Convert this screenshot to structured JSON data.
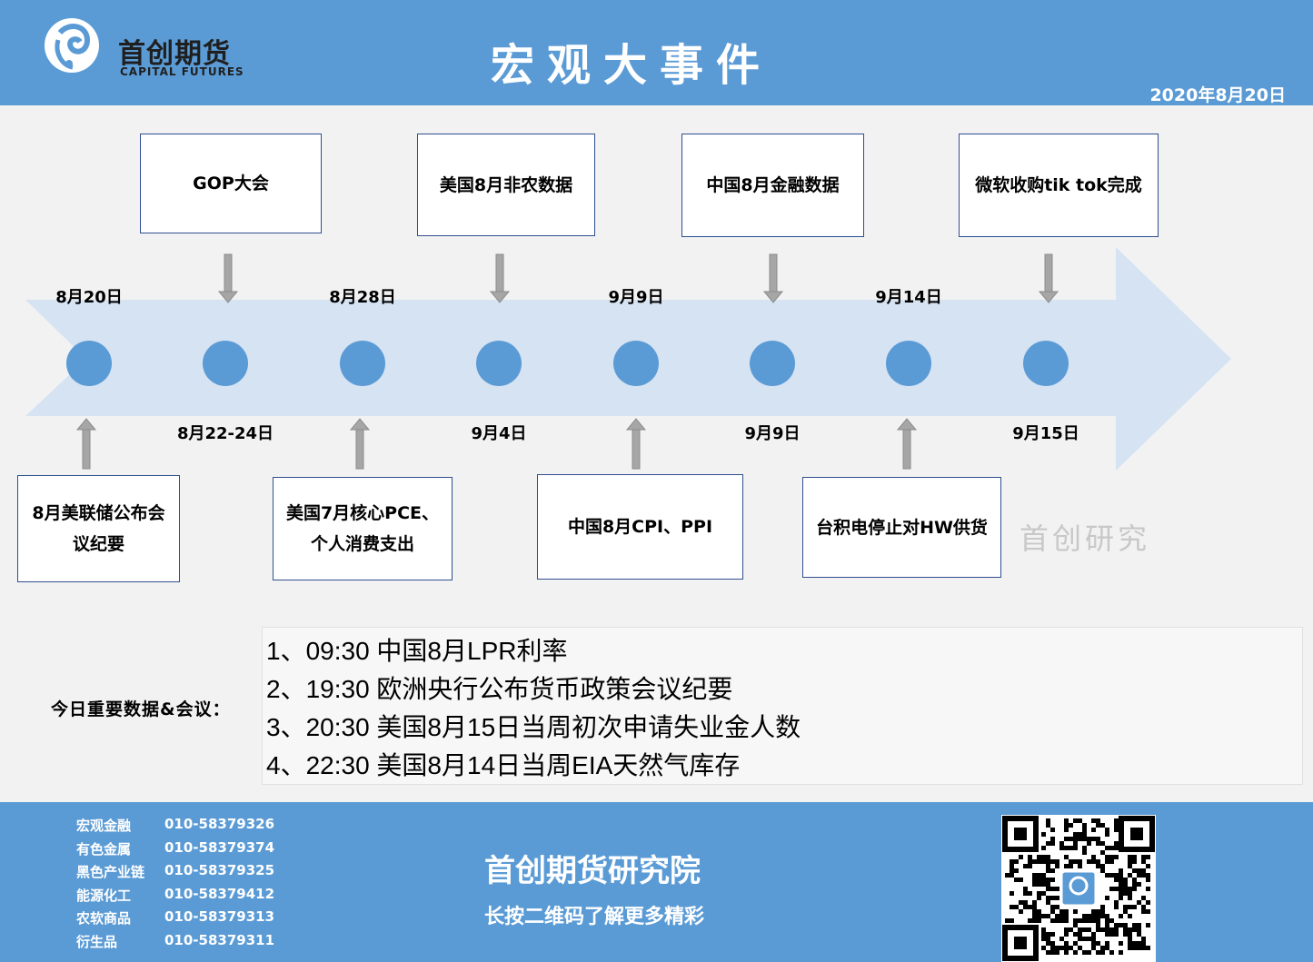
{
  "header": {
    "logo_cn": "首创期货",
    "logo_en": "CAPITAL FUTURES",
    "title": "宏观大事件",
    "date": "2020年8月20日"
  },
  "timeline": {
    "top_dates": [
      "8月20日",
      "8月28日",
      "9月9日",
      "9月14日"
    ],
    "bottom_dates": [
      "8月22-24日",
      "9月4日",
      "9月9日",
      "9月15日"
    ],
    "top_events": [
      "GOP大会",
      "美国8月非农数据",
      "中国8月金融数据",
      "微软收购tik tok完成"
    ],
    "bottom_events": [
      "8月美联储公布会议纪要",
      "美国7月核心PCE、个人消费支出",
      "中国8月CPI、PPI",
      "台积电停止对HW供货"
    ]
  },
  "watermark": "首创研究",
  "today": {
    "label": "今日重要数据&会议：",
    "items": [
      "1、09:30 中国8月LPR利率",
      "2、19:30 欧洲央行公布货币政策会议纪要",
      "3、20:30 美国8月15日当周初次申请失业金人数",
      "4、22:30 美国8月14日当周EIA天然气库存"
    ]
  },
  "footer": {
    "contacts": [
      {
        "dept": "宏观金融",
        "phone": "010-58379326"
      },
      {
        "dept": "有色金属",
        "phone": "010-58379374"
      },
      {
        "dept": "黑色产业链",
        "phone": "010-58379325"
      },
      {
        "dept": "能源化工",
        "phone": "010-58379412"
      },
      {
        "dept": "农软商品",
        "phone": "010-58379313"
      },
      {
        "dept": "衍生品",
        "phone": "010-58379311"
      }
    ],
    "title": "首创期货研究院",
    "subtitle": "长按二维码了解更多精彩"
  },
  "colors": {
    "header_bg": "#5b9bd5",
    "arrow": "#d6e3f3",
    "node": "#5b9bd5",
    "page_bg": "#f2f2f2"
  }
}
